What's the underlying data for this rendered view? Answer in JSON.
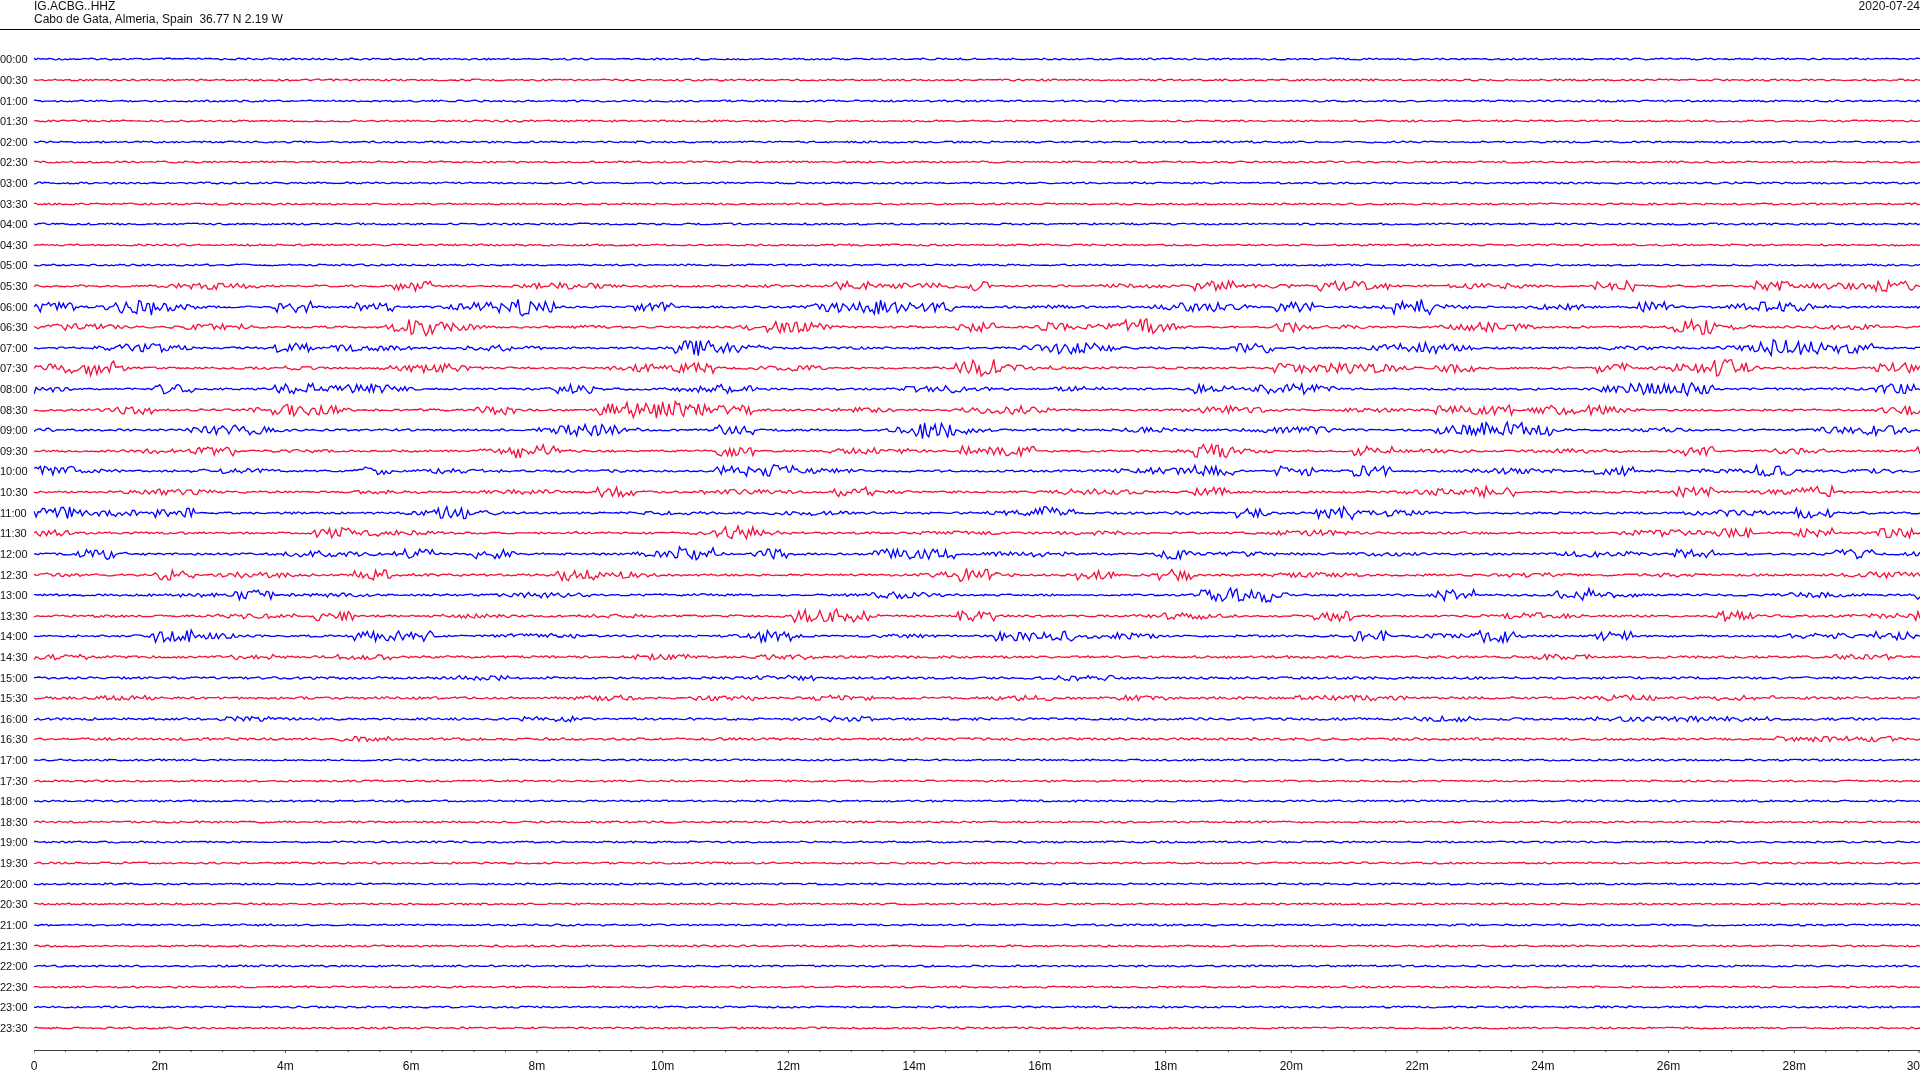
{
  "header": {
    "station": "IG.ACBG..HHZ",
    "location": "Cabo de Gata, Almeria, Spain  36.77 N 2.19 W",
    "date": "2020-07-24"
  },
  "rows": [
    {
      "time": "00:00",
      "color": "#0000ff"
    },
    {
      "time": "00:30",
      "color": "#f5103a"
    },
    {
      "time": "01:00",
      "color": "#0000ff"
    },
    {
      "time": "01:30",
      "color": "#f5103a"
    },
    {
      "time": "02:00",
      "color": "#0000ff"
    },
    {
      "time": "02:30",
      "color": "#f5103a"
    },
    {
      "time": "03:00",
      "color": "#0000ff"
    },
    {
      "time": "03:30",
      "color": "#f5103a"
    },
    {
      "time": "04:00",
      "color": "#0000ff"
    },
    {
      "time": "04:30",
      "color": "#f5103a"
    },
    {
      "time": "05:00",
      "color": "#0000ff"
    },
    {
      "time": "05:30",
      "color": "#f5103a"
    },
    {
      "time": "06:00",
      "color": "#0000ff"
    },
    {
      "time": "06:30",
      "color": "#f5103a"
    },
    {
      "time": "07:00",
      "color": "#0000ff"
    },
    {
      "time": "07:30",
      "color": "#f5103a"
    },
    {
      "time": "08:00",
      "color": "#0000ff"
    },
    {
      "time": "08:30",
      "color": "#f5103a"
    },
    {
      "time": "09:00",
      "color": "#0000ff"
    },
    {
      "time": "09:30",
      "color": "#f5103a"
    },
    {
      "time": "10:00",
      "color": "#0000ff"
    },
    {
      "time": "10:30",
      "color": "#f5103a"
    },
    {
      "time": "11:00",
      "color": "#0000ff"
    },
    {
      "time": "11:30",
      "color": "#f5103a"
    },
    {
      "time": "12:00",
      "color": "#0000ff"
    },
    {
      "time": "12:30",
      "color": "#f5103a"
    },
    {
      "time": "13:00",
      "color": "#0000ff"
    },
    {
      "time": "13:30",
      "color": "#f5103a"
    },
    {
      "time": "14:00",
      "color": "#0000ff"
    },
    {
      "time": "14:30",
      "color": "#f5103a"
    },
    {
      "time": "15:00",
      "color": "#0000ff"
    },
    {
      "time": "15:30",
      "color": "#f5103a"
    },
    {
      "time": "16:00",
      "color": "#0000ff"
    },
    {
      "time": "16:30",
      "color": "#f5103a"
    },
    {
      "time": "17:00",
      "color": "#0000ff"
    },
    {
      "time": "17:30",
      "color": "#f5103a"
    },
    {
      "time": "18:00",
      "color": "#0000ff"
    },
    {
      "time": "18:30",
      "color": "#f5103a"
    },
    {
      "time": "19:00",
      "color": "#0000ff"
    },
    {
      "time": "19:30",
      "color": "#f5103a"
    },
    {
      "time": "20:00",
      "color": "#0000ff"
    },
    {
      "time": "20:30",
      "color": "#f5103a"
    },
    {
      "time": "21:00",
      "color": "#0000ff"
    },
    {
      "time": "21:30",
      "color": "#f5103a"
    },
    {
      "time": "22:00",
      "color": "#0000ff"
    },
    {
      "time": "22:30",
      "color": "#f5103a"
    },
    {
      "time": "23:00",
      "color": "#0000ff"
    },
    {
      "time": "23:30",
      "color": "#f5103a"
    }
  ],
  "x_axis": {
    "ticks": [
      "0",
      "2m",
      "4m",
      "6m",
      "8m",
      "10m",
      "12m",
      "14m",
      "16m",
      "18m",
      "20m",
      "22m",
      "24m",
      "26m",
      "28m",
      "30"
    ]
  }
}
